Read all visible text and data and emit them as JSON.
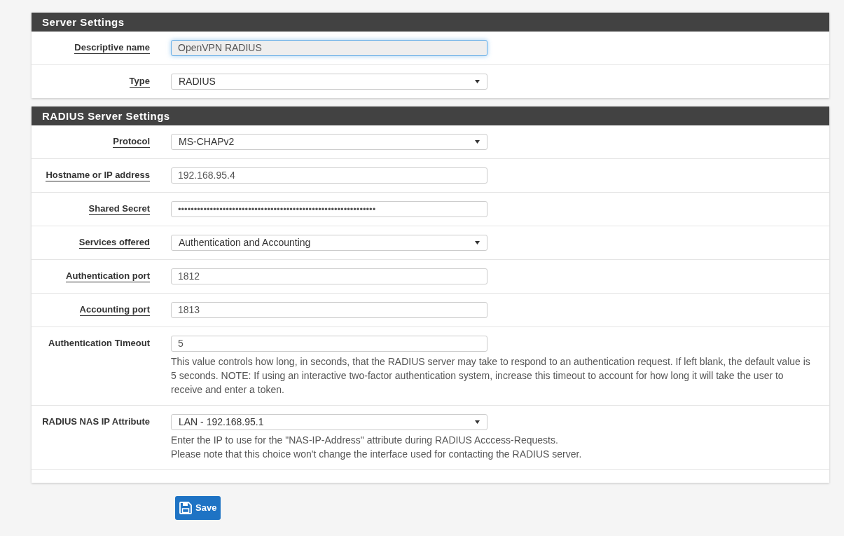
{
  "sections": [
    {
      "title": "Server Settings",
      "rows": [
        {
          "label": "Descriptive name",
          "underlined": true,
          "field": {
            "kind": "input",
            "value": "OpenVPN RADIUS",
            "focused": true,
            "readonly": true
          }
        },
        {
          "label": "Type",
          "underlined": true,
          "field": {
            "kind": "select",
            "value": "RADIUS",
            "focused": false,
            "readonly": false
          }
        }
      ]
    },
    {
      "title": "RADIUS Server Settings",
      "rows": [
        {
          "label": "Protocol",
          "underlined": true,
          "field": {
            "kind": "select",
            "value": "MS-CHAPv2",
            "focused": false,
            "readonly": false
          }
        },
        {
          "label": "Hostname or IP address",
          "underlined": true,
          "field": {
            "kind": "input",
            "value": "192.168.95.4",
            "focused": false,
            "readonly": false
          }
        },
        {
          "label": "Shared Secret",
          "underlined": true,
          "field": {
            "kind": "password",
            "value": "••••••••••••••••••••••••••••••••••••••••••••••••••••••••••••••",
            "focused": false,
            "readonly": false
          }
        },
        {
          "label": "Services offered",
          "underlined": true,
          "field": {
            "kind": "select",
            "value": "Authentication and Accounting",
            "focused": false,
            "readonly": false
          }
        },
        {
          "label": "Authentication port",
          "underlined": true,
          "field": {
            "kind": "input",
            "value": "1812",
            "focused": false,
            "readonly": false
          }
        },
        {
          "label": "Accounting port",
          "underlined": true,
          "field": {
            "kind": "input",
            "value": "1813",
            "focused": false,
            "readonly": false
          }
        },
        {
          "label": "Authentication Timeout",
          "underlined": false,
          "field": {
            "kind": "input",
            "value": "5",
            "focused": false,
            "readonly": false
          },
          "help": [
            "This value controls how long, in seconds, that the RADIUS server may take to respond to an authentication request. If left blank, the default value is 5 seconds. NOTE: If using an interactive two-factor authentication system, increase this timeout to account for how long it will take the user to receive and enter a token."
          ]
        },
        {
          "label": "RADIUS NAS IP Attribute",
          "underlined": false,
          "field": {
            "kind": "select",
            "value": "LAN - 192.168.95.1",
            "focused": false,
            "readonly": false
          },
          "help": [
            "Enter the IP to use for the \"NAS-IP-Address\" attribute during RADIUS Acccess-Requests.",
            "Please note that this choice won't change the interface used for contacting the RADIUS server."
          ]
        }
      ]
    }
  ],
  "save_button": "Save"
}
